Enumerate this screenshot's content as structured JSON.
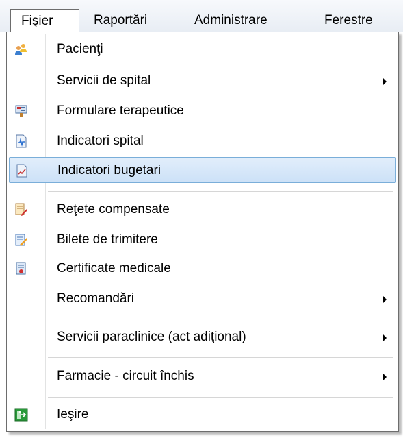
{
  "menubar": {
    "items": [
      {
        "label": "Fişier"
      },
      {
        "label": "Raportări"
      },
      {
        "label": "Administrare"
      },
      {
        "label": "Ferestre"
      }
    ]
  },
  "menu": {
    "items": [
      {
        "label": "Pacienţi",
        "icon": "patients-icon"
      },
      {
        "label": "Servicii de spital",
        "submenu": true
      },
      {
        "label": "Formulare terapeutice",
        "icon": "forms-icon"
      },
      {
        "label": "Indicatori spital",
        "icon": "hospital-indicators-icon"
      },
      {
        "label": "Indicatori bugetari",
        "icon": "budget-indicators-icon",
        "highlighted": true
      },
      {
        "label": "Reţete compensate",
        "icon": "prescriptions-icon"
      },
      {
        "label": "Bilete de trimitere",
        "icon": "referrals-icon"
      },
      {
        "label": "Certificate medicale",
        "icon": "medical-certificates-icon"
      },
      {
        "label": "Recomandări",
        "submenu": true
      },
      {
        "label": "Servicii paraclinice (act adiţional)",
        "submenu": true
      },
      {
        "label": "Farmacie - circuit închis",
        "submenu": true
      },
      {
        "label": "Ieşire",
        "icon": "exit-icon"
      }
    ]
  }
}
